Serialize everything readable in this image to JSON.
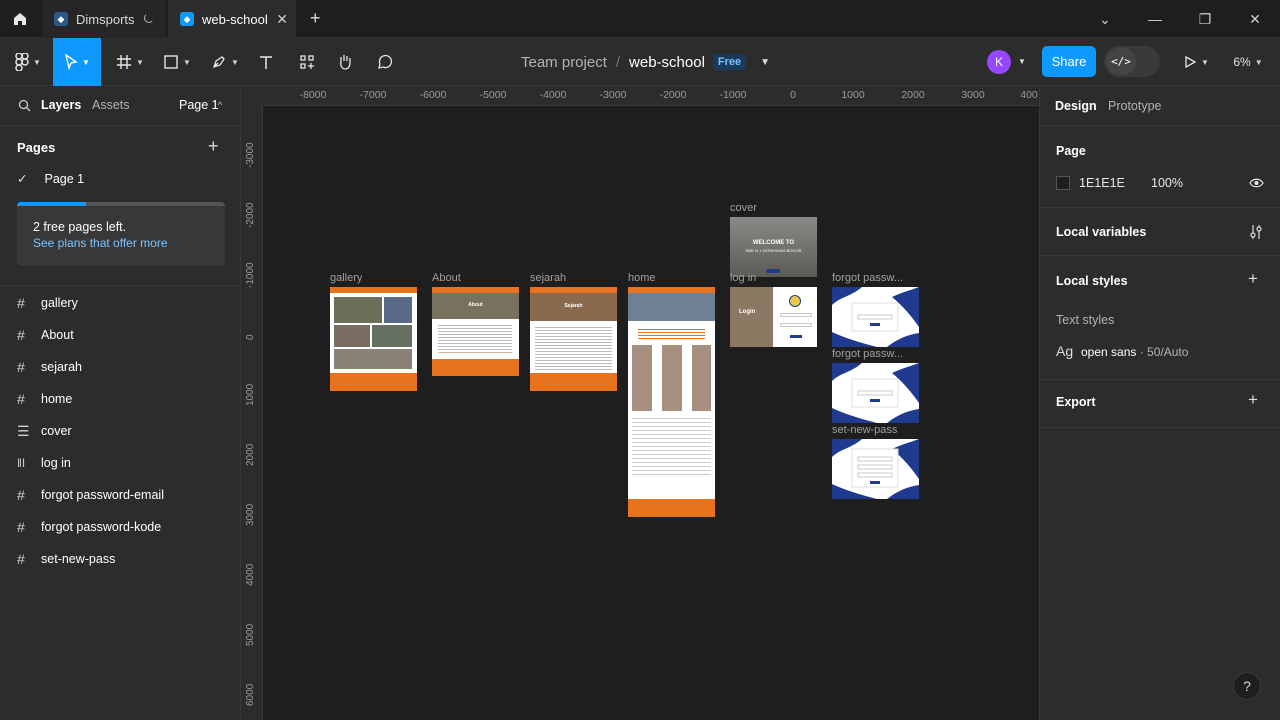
{
  "tabs": [
    {
      "label": "Dimsports",
      "state": "loading"
    },
    {
      "label": "web-school",
      "state": "active"
    }
  ],
  "toolbar": {
    "breadcrumb_team": "Team project",
    "breadcrumb_sep": "/",
    "breadcrumb_file": "web-school",
    "plan_badge": "Free",
    "avatar_initial": "K",
    "share_label": "Share",
    "dev_mode_icon": "</>",
    "zoom": "6%"
  },
  "left_panel": {
    "tab_layers": "Layers",
    "tab_assets": "Assets",
    "page_selector": "Page 1",
    "pages_heading": "Pages",
    "current_page": "Page 1",
    "free_pages_text": "2 free pages left.",
    "free_pages_link": "See plans that offer more",
    "free_pages_used_fraction": 0.33,
    "layers": [
      {
        "name": "gallery",
        "icon": "frame-icon"
      },
      {
        "name": "About",
        "icon": "frame-icon"
      },
      {
        "name": "sejarah",
        "icon": "frame-icon"
      },
      {
        "name": "home",
        "icon": "frame-icon"
      },
      {
        "name": "cover",
        "icon": "autolayout-vertical-icon"
      },
      {
        "name": "log in",
        "icon": "autolayout-horizontal-icon"
      },
      {
        "name": "forgot password-email",
        "icon": "frame-icon"
      },
      {
        "name": "forgot password-kode",
        "icon": "frame-icon"
      },
      {
        "name": "set-new-pass",
        "icon": "frame-icon"
      }
    ]
  },
  "canvas": {
    "ruler_x": [
      "-8000",
      "-7000",
      "-6000",
      "-5000",
      "-4000",
      "-3000",
      "-2000",
      "-1000",
      "0",
      "1000",
      "2000",
      "3000",
      "400"
    ],
    "ruler_y": [
      "-3000",
      "-2000",
      "-1000",
      "0",
      "1000",
      "2000",
      "3000",
      "4000",
      "5000",
      "6000"
    ],
    "frame_labels": {
      "gallery": "gallery",
      "about": "About",
      "sejarah": "sejarah",
      "home": "home",
      "cover": "cover",
      "login": "log in",
      "forgot1": "forgot passw...",
      "forgot2": "forgot passw...",
      "setnew": "set-new-pass"
    },
    "cover_text": "WELCOME TO",
    "cover_subtext": "SMK N 1 KEPAHIANG BOGOR",
    "login_text": "Login",
    "about_title": "About",
    "sejarah_title": "Sejarah"
  },
  "right_panel": {
    "tab_design": "Design",
    "tab_prototype": "Prototype",
    "page_heading": "Page",
    "page_color": "1E1E1E",
    "page_opacity": "100%",
    "local_variables": "Local variables",
    "local_styles": "Local styles",
    "text_styles": "Text styles",
    "text_style_sample": "Ag",
    "text_style_name": "open sans",
    "text_style_meta": " · 50/Auto",
    "export": "Export"
  },
  "help": "?",
  "colors": {
    "accent": "#0d99ff",
    "canvas_bg": "#1e1e1e",
    "panel_bg": "#2c2c2c",
    "orange": "#e8731e",
    "navy": "#1f3a8f"
  }
}
